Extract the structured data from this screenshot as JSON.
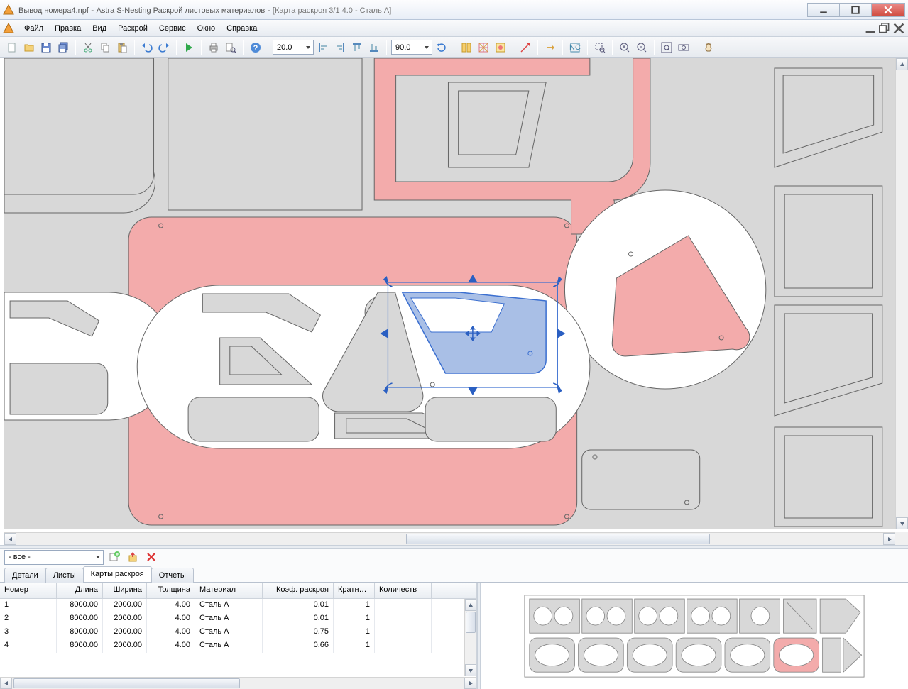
{
  "title": {
    "filename": "Вывод номера4.npf",
    "app": "Astra S-Nesting Раскрой листовых материалов",
    "doc": "[Карта раскроя 3/1 4.0 - Сталь A]"
  },
  "menu": [
    "Файл",
    "Правка",
    "Вид",
    "Раскрой",
    "Сервис",
    "Окно",
    "Справка"
  ],
  "toolbar": {
    "step_value": "20.0",
    "angle_value": "90.0"
  },
  "filter": {
    "value": "- все -"
  },
  "tabs": [
    "Детали",
    "Листы",
    "Карты раскроя",
    "Отчеты"
  ],
  "active_tab": 2,
  "grid": {
    "columns": [
      "Номер",
      "Длина",
      "Ширина",
      "Толщина",
      "Материал",
      "Коэф. раскроя",
      "Кратно…",
      "Количеств"
    ],
    "rows": [
      {
        "id": "1",
        "length": "8000.00",
        "width": "2000.00",
        "thick": "4.00",
        "mat": "Сталь A",
        "coef": "0.01",
        "mult": "1",
        "qty": ""
      },
      {
        "id": "2",
        "length": "8000.00",
        "width": "2000.00",
        "thick": "4.00",
        "mat": "Сталь A",
        "coef": "0.01",
        "mult": "1",
        "qty": ""
      },
      {
        "id": "3",
        "length": "8000.00",
        "width": "2000.00",
        "thick": "4.00",
        "mat": "Сталь A",
        "coef": "0.75",
        "mult": "1",
        "qty": ""
      },
      {
        "id": "4",
        "length": "8000.00",
        "width": "2000.00",
        "thick": "4.00",
        "mat": "Сталь A",
        "coef": "0.66",
        "mult": "1",
        "qty": ""
      }
    ]
  }
}
